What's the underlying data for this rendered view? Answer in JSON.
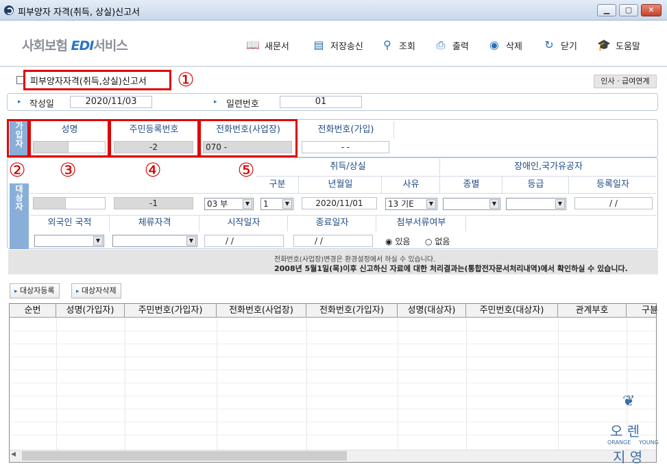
{
  "window": {
    "title": "피부양자 자격(취득, 상실)신고서",
    "min": "▁",
    "max": "▢",
    "close": "✕"
  },
  "toolbar": {
    "logo_prefix": "사회보험",
    "logo_edi": "EDI",
    "logo_suffix": "서비스",
    "buttons": [
      {
        "label": "새문서",
        "icon": "book-icon"
      },
      {
        "label": "저장송신",
        "icon": "save-icon"
      },
      {
        "label": "조회",
        "icon": "search-icon"
      },
      {
        "label": "출력",
        "icon": "print-icon"
      },
      {
        "label": "삭제",
        "icon": "delete-icon"
      },
      {
        "label": "닫기",
        "icon": "close-icon"
      },
      {
        "label": "도움말",
        "icon": "help-icon"
      }
    ]
  },
  "form": {
    "title": "피부양자자격(취득,상실)신고서",
    "hr_link": "인사 · 급여연계",
    "date_label": "작성일",
    "date_value": "2020/11/03",
    "serial_label": "일련번호",
    "serial_value": "01"
  },
  "annotations": {
    "n1": "①",
    "n2": "②",
    "n3": "③",
    "n4": "④",
    "n5": "⑤"
  },
  "subscriber": {
    "side_label": "가\n입\n자",
    "name_header": "성명",
    "rrn_header": "주민등록번호",
    "phone_work_header": "전화번호(사업장)",
    "phone_sub_header": "전화번호(가입)",
    "rrn_value": "-2",
    "phone_work_value": "070 -",
    "phone_sub_value": "-        -"
  },
  "target": {
    "side_label": "대\n상\n자",
    "acq_loss_header": "취득/상실",
    "gubun_header": "구분",
    "ymd_header": "년월일",
    "reason_header": "사유",
    "disabled_header": "장애인,국가유공자",
    "kind_header": "종별",
    "grade_header": "등급",
    "reg_date_header": "등록일자",
    "rrn_value": "-1",
    "relation_value": "03   부",
    "gubun_value": "1",
    "ymd_value": "2020/11/01",
    "reason_value": "13   기E",
    "reg_date_value": "/  /",
    "foreign_header": "외국인 국적",
    "stay_header": "체류자격",
    "start_header": "시작일자",
    "end_header": "종료일자",
    "attach_header": "첨부서류여부",
    "start_value": "/  /",
    "end_value": "/  /",
    "attach_yes": "있음",
    "attach_no": "없음"
  },
  "notice": {
    "line1": "전화번호(사업장)변경은 환경설정에서 하실 수 있습니다.",
    "line2": "2008년 5월1일(목)이후 신고하신 자료에 대한 처리결과는(통합전자문서처리내역)에서 확인하실 수 있습니다."
  },
  "buttons": {
    "register": "대상자등록",
    "delete": "대상자삭제"
  },
  "grid": {
    "columns": [
      "순번",
      "성명(가입자)",
      "주민번호(가입자)",
      "전화번호(사업장)",
      "전화번호(가입자)",
      "성명(대상자)",
      "주민번호(대상자)",
      "관계부호",
      "구뷴"
    ]
  },
  "watermark": {
    "line1": "오  렌",
    "line2": "지  영",
    "en1": "ORANGE",
    "en2": "YOUNG"
  }
}
